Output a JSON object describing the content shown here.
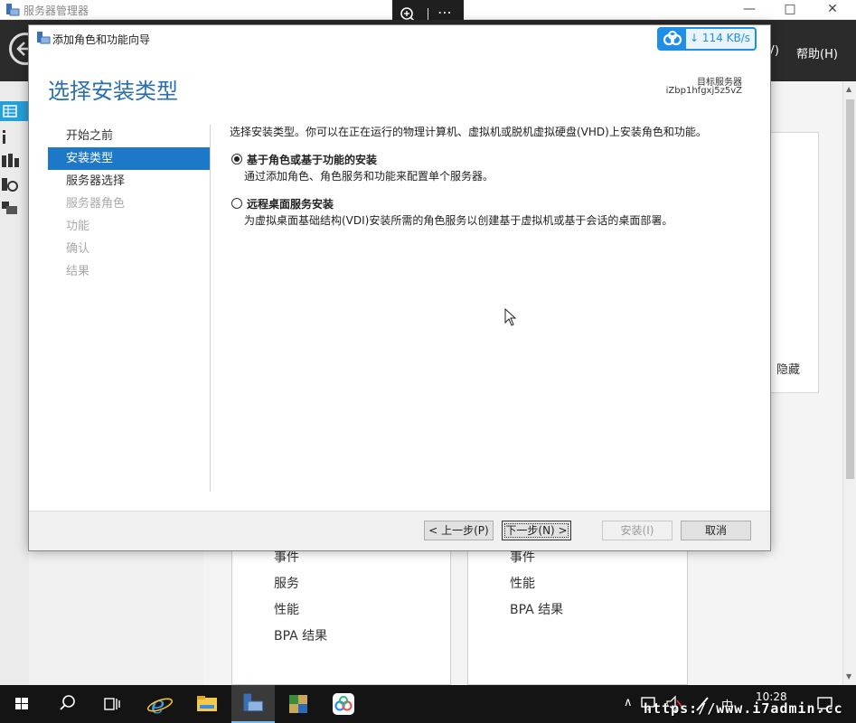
{
  "server_manager": {
    "title": "服务器管理器",
    "menu_view": "V)",
    "menu_help": "帮助(H)",
    "hide_label": "隐藏",
    "tile_left": [
      "事件",
      "服务",
      "性能",
      "BPA 结果"
    ],
    "tile_right": [
      "事件",
      "性能",
      "BPA 结果"
    ]
  },
  "wizard": {
    "title": "添加角色和功能向导",
    "heading": "选择安装类型",
    "target_label": "目标服务器",
    "target_server": "iZbp1hfgxj5z5vZ",
    "steps": [
      {
        "label": "开始之前",
        "state": "normal"
      },
      {
        "label": "安装类型",
        "state": "active"
      },
      {
        "label": "服务器选择",
        "state": "normal"
      },
      {
        "label": "服务器角色",
        "state": "disabled"
      },
      {
        "label": "功能",
        "state": "disabled"
      },
      {
        "label": "确认",
        "state": "disabled"
      },
      {
        "label": "结果",
        "state": "disabled"
      }
    ],
    "intro": "选择安装类型。你可以在正在运行的物理计算机、虚拟机或脱机虚拟硬盘(VHD)上安装角色和功能。",
    "options": [
      {
        "label": "基于角色或基于功能的安装",
        "desc": "通过添加角色、角色服务和功能来配置单个服务器。",
        "checked": true
      },
      {
        "label": "远程桌面服务安装",
        "desc": "为虚拟桌面基础结构(VDI)安装所需的角色服务以创建基于虚拟机或基于会话的桌面部署。",
        "checked": false
      }
    ],
    "buttons": {
      "prev": "< 上一步(P)",
      "next": "下一步(N) >",
      "install": "安装(I)",
      "cancel": "取消"
    }
  },
  "speed_badge": {
    "text": "114 KB/s"
  },
  "taskbar": {
    "time": "10:28",
    "ime": "中",
    "watermark": "https://www.i7admin.cc"
  },
  "colors": {
    "accent": "#1e78c8",
    "heading": "#2b6fb0",
    "taskbar": "#141414"
  }
}
